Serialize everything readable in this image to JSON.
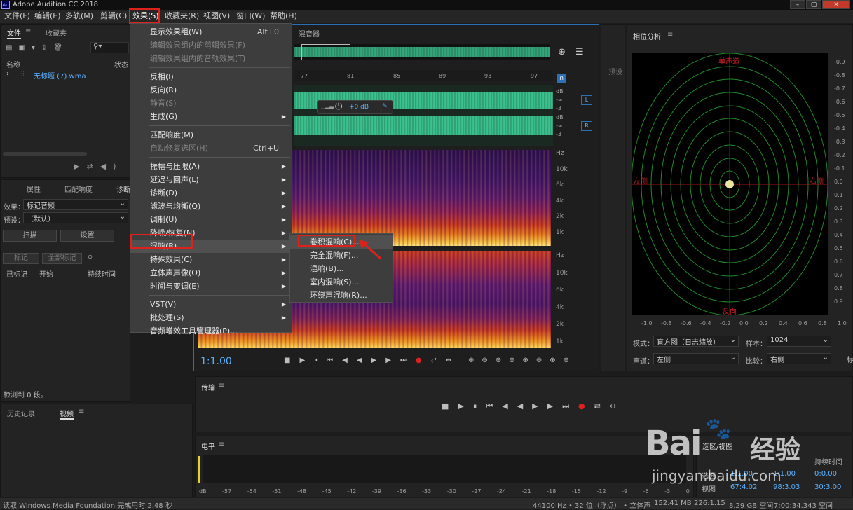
{
  "window": {
    "title": "Adobe Audition CC 2018",
    "icon": "Au"
  },
  "menubar": [
    "文件(F)",
    "编辑(E)",
    "多轨(M)",
    "剪辑(C)",
    "效果(S)",
    "收藏夹(R)",
    "视图(V)",
    "窗口(W)",
    "帮助(H)"
  ],
  "files_panel": {
    "tabs": [
      "文件",
      "收藏夹"
    ],
    "col_name": "名称",
    "col_status": "状态",
    "file": "无标题 (7).wma"
  },
  "props_panel": {
    "tabs": [
      "属性",
      "匹配响度",
      "诊断"
    ],
    "effect_label": "效果：",
    "effect_value": "标记音频",
    "preset_label": "预设：",
    "preset_value": "（默认）",
    "scan": "扫描",
    "settings": "设置",
    "mark": "标记",
    "mark_all": "全部标记",
    "col_marked": "已标记",
    "col_start": "开始",
    "col_duration": "持续时间",
    "status": "检测到 0 段。"
  },
  "history": {
    "tabs": [
      "历史记录",
      "视频"
    ]
  },
  "editor": {
    "mixer_tab": "混音器",
    "ruler": [
      "77",
      "81",
      "85",
      "89",
      "93",
      "97"
    ],
    "db_top": [
      "dB",
      "-∞",
      "-3"
    ],
    "db_bot": [
      "dB",
      "-∞",
      "-3"
    ],
    "ch_left": "L",
    "ch_right": "R",
    "gain": "+0 dB",
    "hz_top": [
      "Hz",
      "10k",
      "6k",
      "4k",
      "2k",
      "1k"
    ],
    "hz_bot": [
      "Hz",
      "10k",
      "6k",
      "4k",
      "2k",
      "1k"
    ],
    "time": "1:1.00"
  },
  "effects_menu": {
    "items": [
      {
        "label": "显示效果组(W)",
        "shortcut": "Alt+0",
        "disabled": false
      },
      {
        "label": "编辑效果组内的剪辑效果(F)",
        "disabled": true
      },
      {
        "label": "编辑效果组内的音轨效果(T)",
        "disabled": true
      },
      {
        "label": "反相(I)"
      },
      {
        "label": "反向(R)"
      },
      {
        "label": "静音(S)",
        "disabled": true
      },
      {
        "label": "生成(G)",
        "sub": true
      },
      {
        "label": "匹配响度(M)"
      },
      {
        "label": "自动修复选区(H)",
        "shortcut": "Ctrl+U",
        "disabled": true
      },
      {
        "label": "振幅与压限(A)",
        "sub": true
      },
      {
        "label": "延迟与回声(L)",
        "sub": true
      },
      {
        "label": "诊断(D)",
        "sub": true
      },
      {
        "label": "滤波与均衡(Q)",
        "sub": true
      },
      {
        "label": "调制(U)",
        "sub": true
      },
      {
        "label": "降噪/恢复(N)",
        "sub": true
      },
      {
        "label": "混响(B)",
        "sub": true
      },
      {
        "label": "特殊效果(C)",
        "sub": true
      },
      {
        "label": "立体声声像(O)",
        "sub": true
      },
      {
        "label": "时间与变调(E)",
        "sub": true
      },
      {
        "label": "VST(V)",
        "sub": true
      },
      {
        "label": "批处理(S)",
        "sub": true
      },
      {
        "label": "音频增效工具管理器(P)..."
      }
    ]
  },
  "reverb_submenu": [
    "卷积混响(C)...",
    "完全混响(F)...",
    "混响(B)...",
    "室内混响(S)...",
    "环绕声混响(R)..."
  ],
  "transport": {
    "label": "传输"
  },
  "levels": {
    "label": "电平",
    "ticks": [
      "dB",
      "-57",
      "-54",
      "-51",
      "-48",
      "-45",
      "-42",
      "-39",
      "-36",
      "-33",
      "-30",
      "-27",
      "-24",
      "-21",
      "-18",
      "-15",
      "-12",
      "-9",
      "-6",
      "-3",
      "0"
    ]
  },
  "selection": {
    "title": "选区/视图",
    "duration_label": "持续时间",
    "sel_label": "选区",
    "view_label": "视图",
    "sel_start": "1:1.00",
    "sel_end": "1:1.00",
    "sel_dur": "0:0.00",
    "view_start": "67:4.02",
    "view_end": "98:3.03",
    "view_dur": "30:3.00"
  },
  "phase": {
    "title": "相位分析",
    "top": "单声道",
    "bottom": "反向",
    "left": "左侧",
    "right": "右侧",
    "x_ticks": [
      "-1.0",
      "-0.8",
      "-0.6",
      "-0.4",
      "-0.2",
      "0.0",
      "0.2",
      "0.4",
      "0.6",
      "0.8",
      "1.0"
    ],
    "y_ticks": [
      "-0.9",
      "-0.8",
      "-0.7",
      "-0.6",
      "-0.5",
      "-0.4",
      "-0.3",
      "-0.2",
      "-0.1",
      "0.0",
      "0.1",
      "0.2",
      "0.3",
      "0.4",
      "0.5",
      "0.6",
      "0.7",
      "0.8",
      "0.9"
    ],
    "mode_label": "模式：",
    "mode_value": "直方图（日志缩放）",
    "sample_label": "样本：",
    "sample_value": "1024",
    "channel_label": "声道：",
    "channel_value": "左侧",
    "compare_label": "比较：",
    "compare_value": "右侧",
    "extra": "标",
    "preset_tab": "预设"
  },
  "statusbar": {
    "left": "读取 Windows Media Foundation 完成用时 2.48 秒",
    "sr": "44100 Hz",
    "bits": "32 位（浮点）",
    "ch": "立体声",
    "size": "152.41 MB",
    "dur": "226:1.15",
    "free": "8.29 GB 空间",
    "free_time": "7:00:34.343 空间"
  },
  "watermark": {
    "brand": "Bai",
    "brand2": "经验",
    "url": "jingyan.baidu.com"
  },
  "colors": {
    "accent": "#2b6fb4",
    "highlight": "#e0201a",
    "wave": "#46e3a6"
  }
}
